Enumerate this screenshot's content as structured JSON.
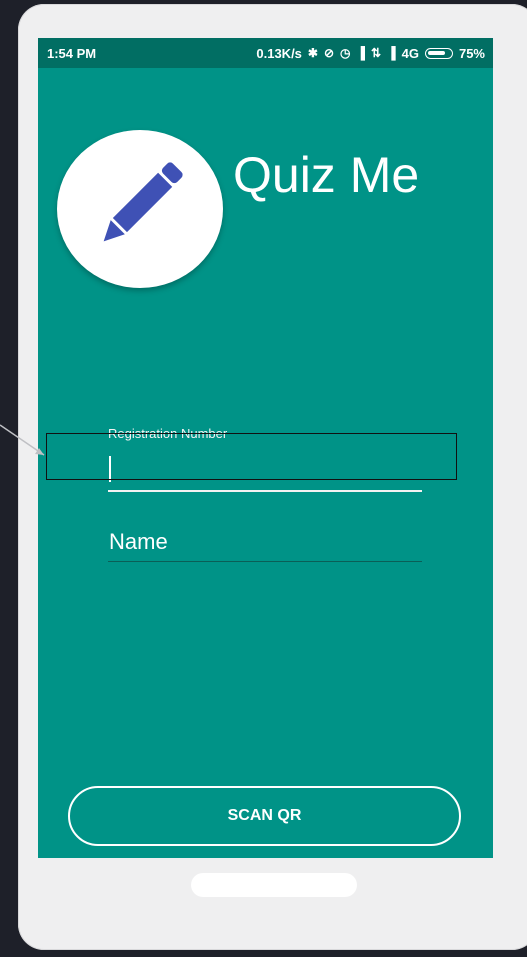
{
  "statusbar": {
    "time": "1:54 PM",
    "speed": "0.13K/s",
    "network": "4G",
    "battery": "75%"
  },
  "app": {
    "title": "Quiz Me",
    "logo_icon": "pencil-icon"
  },
  "form": {
    "registration_label": "Registration Number",
    "name_label": "Name"
  },
  "actions": {
    "scan_label": "SCAN QR"
  },
  "colors": {
    "primary": "#009387",
    "statusbar": "#016e63",
    "pencil": "#3f51b5",
    "frame": "#efeff0",
    "background": "#1e2029"
  }
}
